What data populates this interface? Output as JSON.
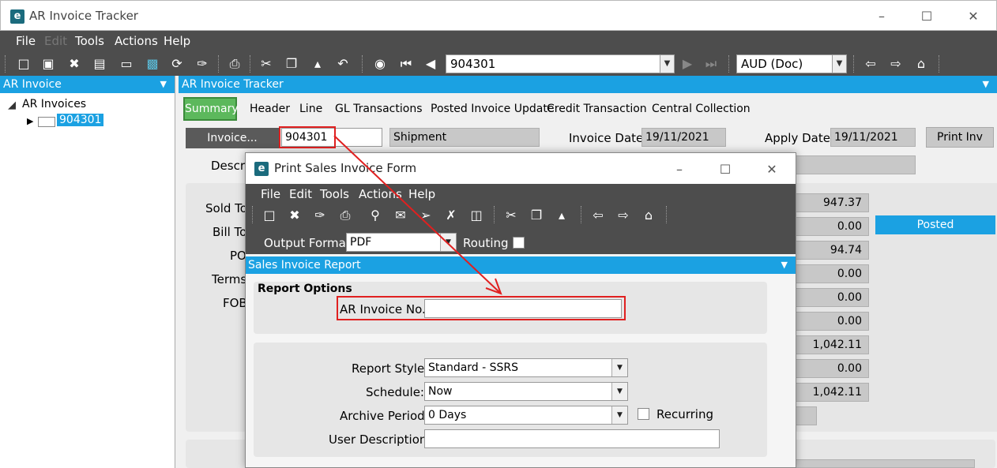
{
  "window": {
    "title": "AR Invoice Tracker"
  },
  "menu": [
    "File",
    "Edit",
    "Tools",
    "Actions",
    "Help"
  ],
  "toolbar": {
    "invoice_value": "904301",
    "currency": "AUD (Doc)"
  },
  "left_panel": {
    "header": "AR Invoice",
    "tree_root": "AR Invoices",
    "tree_child": "904301"
  },
  "main": {
    "header": "AR Invoice Tracker",
    "tabs": [
      "Summary",
      "Header",
      "Line",
      "GL Transactions",
      "Posted Invoice Update",
      "Credit Transaction",
      "Central Collection"
    ],
    "invoice_btn": "Invoice...",
    "invoice_no": "904301",
    "shipment": "Shipment",
    "invoice_date_label": "Invoice Date:",
    "invoice_date": "19/11/2021",
    "apply_date_label": "Apply Date:",
    "apply_date": "19/11/2021",
    "print_btn": "Print Inv",
    "descr_label": "Descri",
    "left_labels": [
      "Sold To",
      "Bill To",
      "PO",
      "Terms",
      "FOB"
    ],
    "amounts": [
      "947.37",
      "0.00",
      "94.74",
      "0.00",
      "0.00",
      "0.00",
      "1,042.11",
      "0.00",
      "1,042.11"
    ],
    "status": "Posted"
  },
  "dialog": {
    "title": "Print Sales Invoice Form",
    "menu": [
      "File",
      "Edit",
      "Tools",
      "Actions",
      "Help"
    ],
    "output_format_label": "Output Format:",
    "output_format": "PDF",
    "routing_label": "Routing",
    "header": "Sales Invoice Report",
    "report_options": "Report Options",
    "ar_invoice_label": "AR Invoice No.:",
    "ar_invoice_value": "",
    "report_style_label": "Report Style:",
    "report_style": "Standard - SSRS",
    "schedule_label": "Schedule:",
    "schedule": "Now",
    "archive_label": "Archive Period:",
    "archive": "0 Days",
    "recurring_label": "Recurring",
    "user_desc_label": "User Description:",
    "user_desc": ""
  },
  "colors": {
    "accent": "#1ba1e2",
    "toolbar": "#4d4d4d",
    "highlight": "#e02020",
    "tab_active": "#5cb85c"
  }
}
